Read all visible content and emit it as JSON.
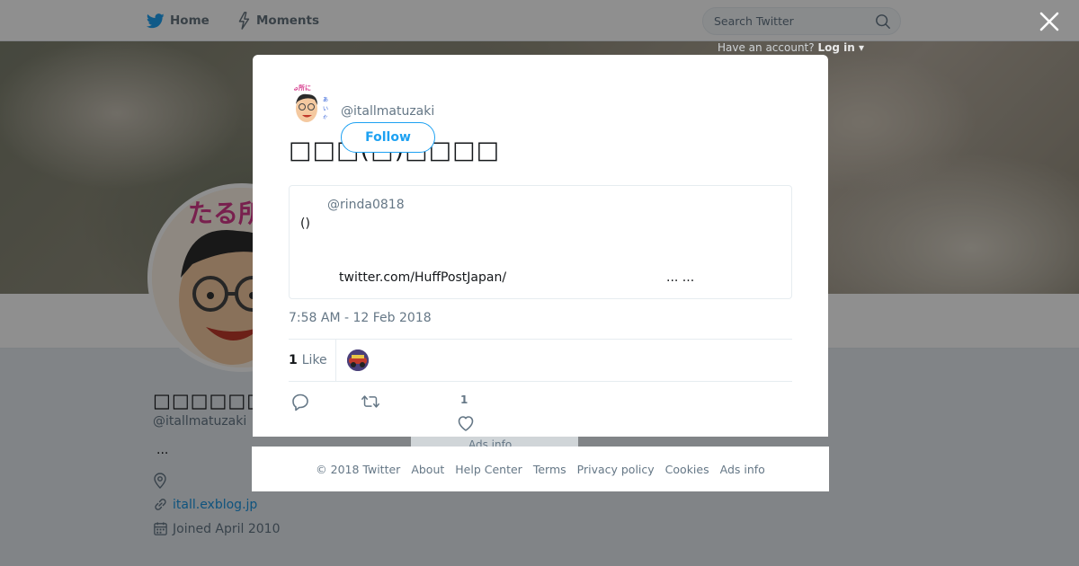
{
  "nav": {
    "home_label": "Home",
    "moments_label": "Moments",
    "search_placeholder": "Search Twitter",
    "login_prompt": "Have an account?",
    "login_label": "Log in"
  },
  "profile": {
    "name": "□□□□□□□□□□",
    "handle": "@itallmatuzaki",
    "bio": "...",
    "url": "itall.exblog.jp",
    "joined": "Joined April 2010"
  },
  "tweet": {
    "handle": "@itallmatuzaki",
    "follow_label": "Follow",
    "text": "□□□(□)□□□□",
    "quote": {
      "handle": "@rinda0818",
      "text": "()",
      "link": "twitter.com/HuffPostJapan/",
      "ellipsis": "... ..."
    },
    "timestamp": "7:58 AM - 12 Feb 2018",
    "like_count": "1",
    "like_label": "Like",
    "action_like_count": "1"
  },
  "ads_peek": "Ads info",
  "footer": {
    "copyright": "© 2018 Twitter",
    "links": [
      "About",
      "Help Center",
      "Terms",
      "Privacy policy",
      "Cookies",
      "Ads info"
    ]
  },
  "icons": {
    "home": "bird-icon",
    "moments": "lightning-icon",
    "search": "search-icon",
    "close": "close-icon",
    "location": "location-icon",
    "link": "link-icon",
    "calendar": "calendar-icon",
    "reply": "reply-icon",
    "retweet": "retweet-icon",
    "like": "heart-icon"
  },
  "colors": {
    "brand_blue": "#1da1f2",
    "link_blue": "#1b95e0",
    "muted": "#657786"
  }
}
